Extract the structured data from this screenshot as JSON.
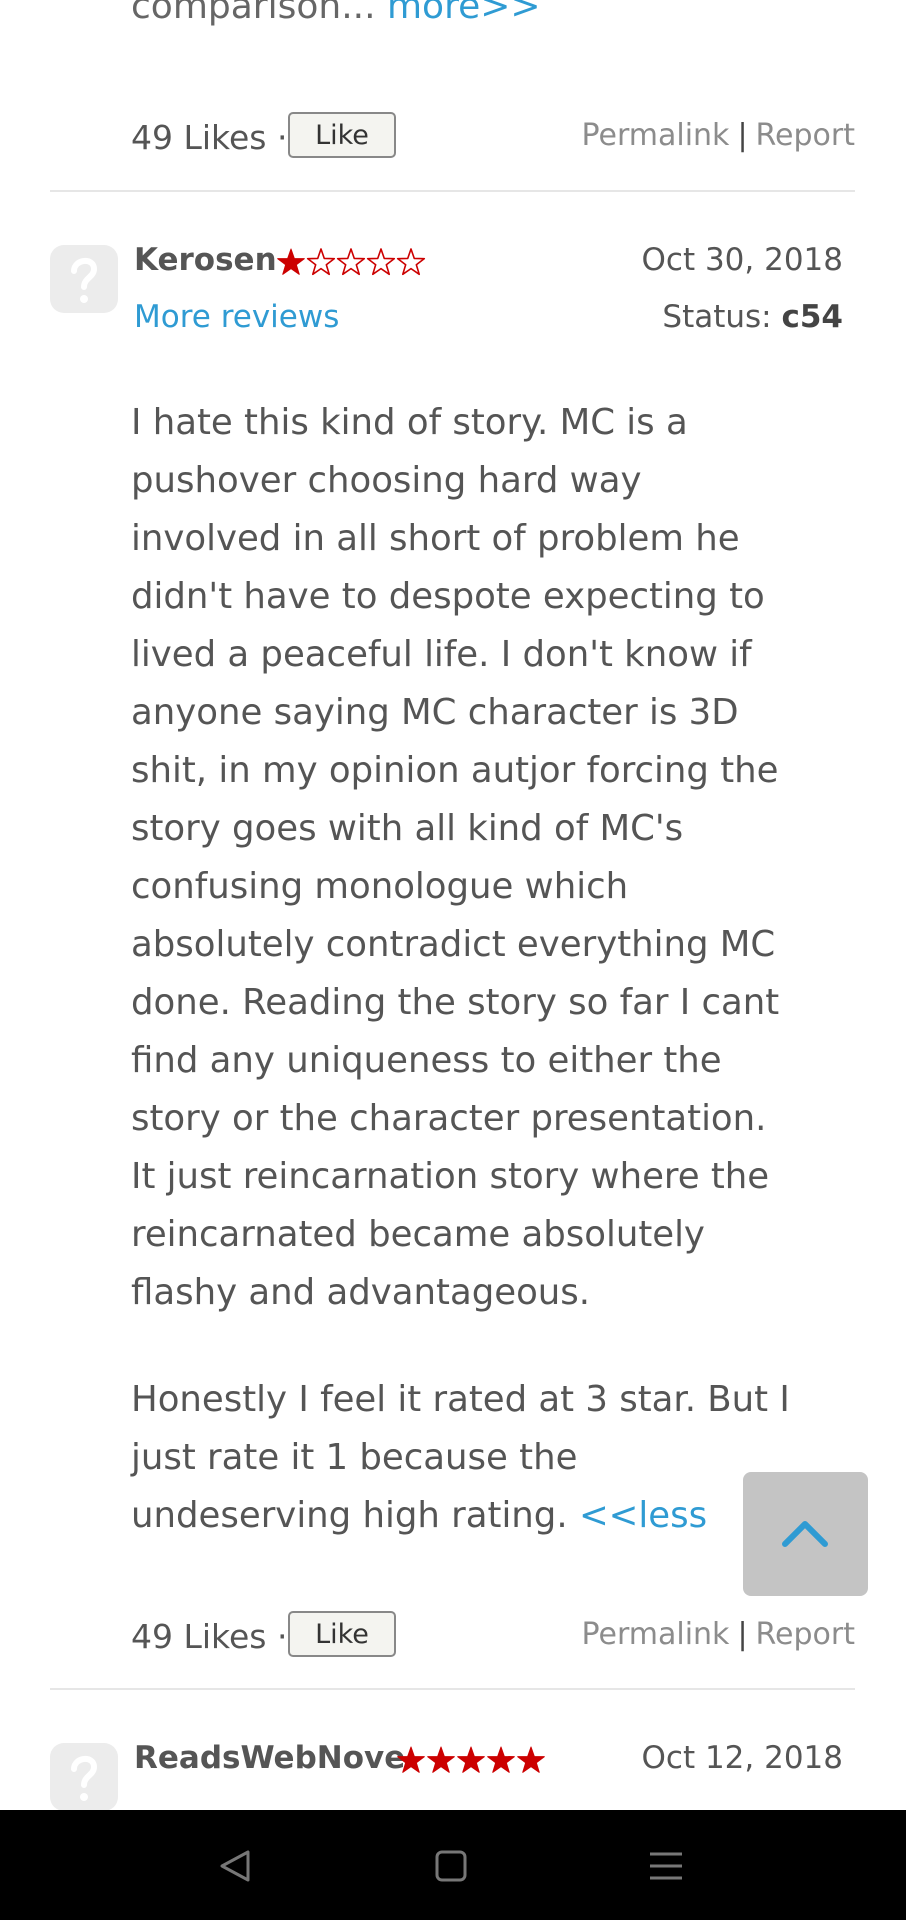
{
  "previous_review": {
    "tail_text": "comparison...",
    "more_link": "more>>",
    "likes": "49 Likes",
    "dot": "·",
    "like_button": "Like",
    "permalink": "Permalink",
    "separator": "|",
    "report": "Report"
  },
  "review": {
    "reviewer": "Kerosen",
    "rating": 1,
    "max_rating": 5,
    "date": "Oct 30, 2018",
    "more_reviews": "More reviews",
    "status_label": "Status:",
    "status_value": "c54",
    "paragraph_1": "I hate this kind of story. MC is a pushover choosing hard way involved in all short of problem he didn't have to despote expecting to lived a peaceful life. I don't know if anyone saying MC character is 3D shit, in my opinion autjor forcing the story goes with all kind of MC's confusing monologue which absolutely contradict everything MC done. Reading the story so far I cant find any uniqueness to either the story or the character presentation. It just reincarnation story where the reincarnated became absolutely flashy and advantageous.",
    "paragraph_2": "Honestly I feel it rated at 3 star. But I just rate it 1 because the undeserving high rating.",
    "less_link": "<<less",
    "likes": "49 Likes",
    "dot": "·",
    "like_button": "Like",
    "permalink": "Permalink",
    "separator": "|",
    "report": "Report"
  },
  "next_review": {
    "reviewer": "ReadsWebNove",
    "rating": 5,
    "max_rating": 5,
    "date": "Oct 12, 2018"
  },
  "colors": {
    "link": "#2f9bd3",
    "star": "#cc0000",
    "back_to_top": "#c4c4c4",
    "back_to_top_arrow": "#2f9bd3",
    "navbar": "#000000"
  },
  "icons": {
    "avatar": "question-mark-avatar-icon",
    "back_to_top": "chevron-up-icon",
    "nav_back": "triangle-back-icon",
    "nav_home": "square-home-icon",
    "nav_menu": "hamburger-menu-icon"
  }
}
